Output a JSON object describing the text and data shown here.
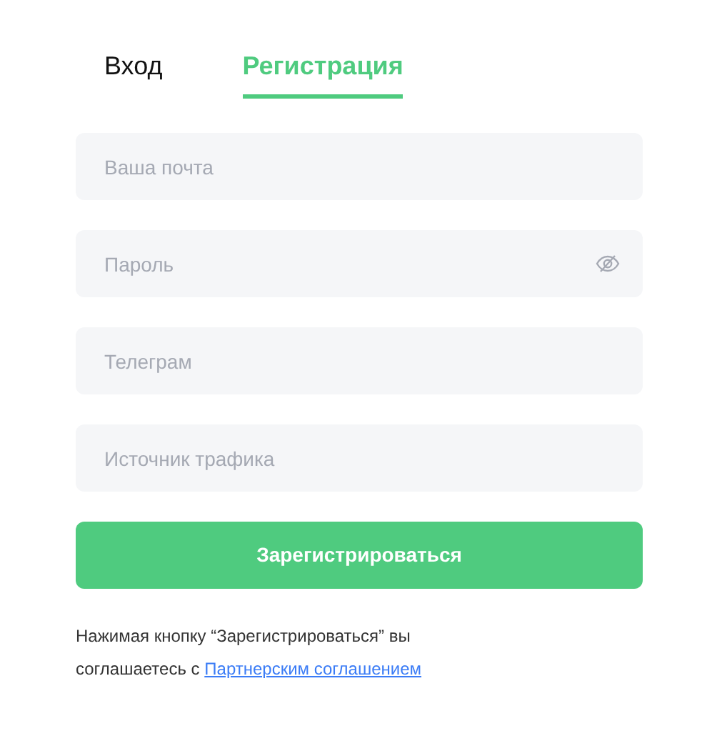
{
  "tabs": [
    {
      "label": "Вход",
      "selected": false
    },
    {
      "label": "Регистрация",
      "selected": true
    }
  ],
  "fields": [
    {
      "kind": "text",
      "placeholder": "Ваша почта"
    },
    {
      "kind": "password",
      "placeholder": "Пароль"
    },
    {
      "kind": "text",
      "placeholder": "Телеграм"
    },
    {
      "kind": "text",
      "placeholder": "Источник трафика"
    }
  ],
  "submit_button": "Зарегистрироваться",
  "notice": {
    "text": "Нажимая кнопку “Зарегистрироваться” вы соглашаетесь с ",
    "link": "Партнерским соглашением"
  }
}
